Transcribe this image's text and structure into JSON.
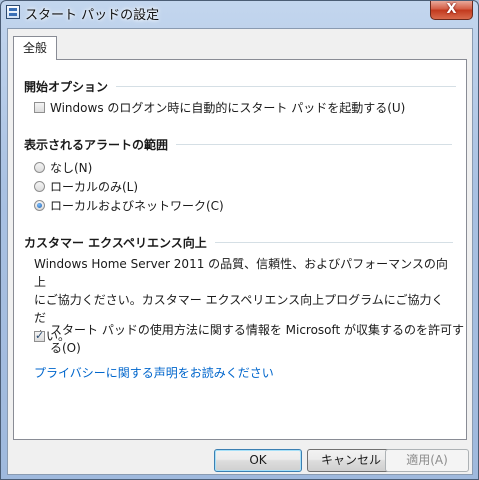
{
  "window": {
    "title": "スタート パッドの設定",
    "close_label": "X"
  },
  "tabs": [
    {
      "label": "全般"
    }
  ],
  "startup": {
    "heading": "開始オプション",
    "checkbox_label": "Windows のログオン時に自動的にスタート パッドを起動する(U)",
    "checked": false
  },
  "alerts": {
    "heading": "表示されるアラートの範囲",
    "options": [
      {
        "label": "なし(N)",
        "selected": false
      },
      {
        "label": "ローカルのみ(L)",
        "selected": false
      },
      {
        "label": "ローカルおよびネットワーク(C)",
        "selected": true
      }
    ]
  },
  "ceip": {
    "heading": "カスタマー エクスペリエンス向上",
    "desc_line1": "Windows Home Server 2011 の品質、信頼性、およびパフォーマンスの向上",
    "desc_line2": "にご協力ください。カスタマー エクスペリエンス向上プログラムにご協力くだ",
    "desc_line3": "さい。",
    "checkbox_line1": "スタート パッドの使用方法に関する情報を Microsoft が収集するのを許可す",
    "checkbox_line2": "る(O)",
    "checked": true,
    "privacy_link": "プライバシーに関する声明をお読みください"
  },
  "buttons": {
    "ok": "OK",
    "cancel": "キャンセル",
    "apply": "適用(A)"
  },
  "colors": {
    "link": "#0066cc",
    "title_glass": "#a9c1e2",
    "close_red": "#c2391d"
  }
}
